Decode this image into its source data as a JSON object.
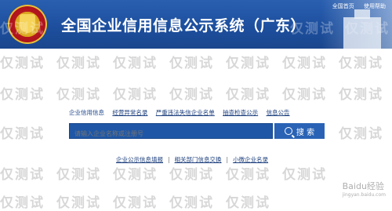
{
  "header": {
    "title": "全国企业信用信息公示系统（广东）",
    "links": [
      "全国首页",
      "使用帮助"
    ]
  },
  "nav": {
    "items": [
      "企业信用信息",
      "经营异常名录",
      "严重违法失信企业名单",
      "抽查检查公示",
      "信息公告"
    ]
  },
  "search": {
    "placeholder": "请输入企业名称或注册号",
    "button_label": "搜 索"
  },
  "bottom_links": [
    "企业公示信息填报",
    "相关部门信息交换",
    "小微企业名录"
  ],
  "watermark": "仅测试",
  "baidu": {
    "name": "Baidu经验",
    "url": "jingyan.baidu.com"
  },
  "colors": {
    "header_blue": "#1d4f9e",
    "search_blue": "#1f57a6",
    "link_blue": "#1d3f7d"
  }
}
